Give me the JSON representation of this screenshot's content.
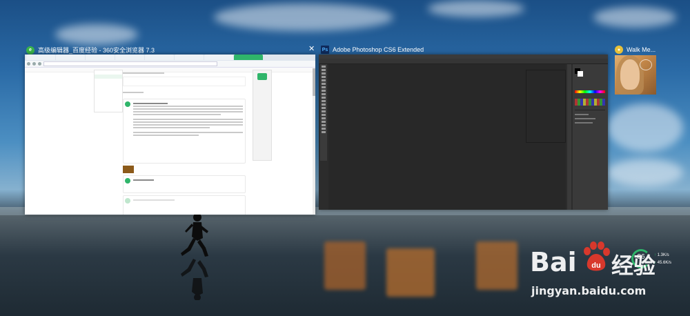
{
  "browser_window": {
    "title": "高级编辑器_百度经验 - 360安全浏览器 7.3",
    "icon": "360-browser-icon"
  },
  "photoshop_window": {
    "title": "Adobe Photoshop CS6 Extended",
    "icon_label": "Ps"
  },
  "walk_me_window": {
    "title": "Walk Me..."
  },
  "network_widget": {
    "percent": "86",
    "upload": "1.3K/s",
    "download": "45.6K/s"
  },
  "watermark": {
    "brand_text": "Bai",
    "brand_text2": "du",
    "cn_text": "经验",
    "url": "jingyan.baidu.com"
  },
  "colors": {
    "browser_accent": "#2fb56a",
    "ps_blue": "#0f2b5c",
    "baidu_red": "#d8382c"
  }
}
